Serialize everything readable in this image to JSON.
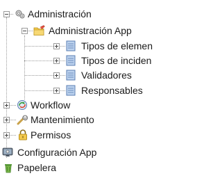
{
  "tree": {
    "root": {
      "label": "Administración",
      "children": {
        "admin_app": {
          "label": "Administración App",
          "children": [
            {
              "label": "Tipos de elemen"
            },
            {
              "label": "Tipos de inciden"
            },
            {
              "label": "Validadores"
            },
            {
              "label": "Responsables"
            }
          ]
        },
        "workflow": {
          "label": "Workflow"
        },
        "mantenimiento": {
          "label": "Mantenimiento"
        },
        "permisos": {
          "label": "Permisos"
        }
      }
    },
    "configuracion": {
      "label": "Configuración App"
    },
    "papelera": {
      "label": "Papelera"
    }
  },
  "colors": {
    "tree_line": "#9a9a9a",
    "folder": "#f3c94a",
    "doc": "#bcd2ee"
  },
  "icons": {
    "root": "admin-gears-icon",
    "admin_app": "folder-pencil-icon",
    "leaf": "document-icon",
    "workflow": "workflow-icon",
    "mantenimiento": "wrench-icon",
    "permisos": "padlock-icon",
    "configuracion": "monitor-config-icon",
    "papelera": "recycle-bin-icon"
  }
}
